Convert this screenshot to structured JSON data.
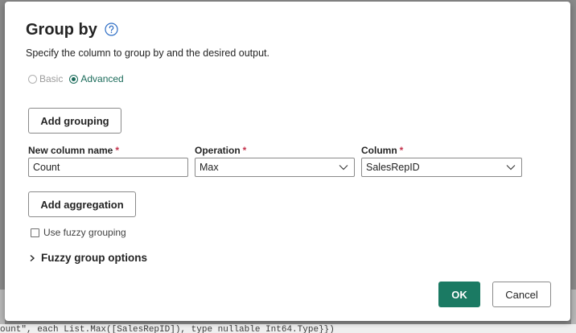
{
  "background": {
    "code_line": "ount\", each List.Max([SalesRepID]), type nullable Int64.Type}})"
  },
  "dialog": {
    "title": "Group by",
    "subtitle": "Specify the column to group by and the desired output.",
    "modes": {
      "basic_label": "Basic",
      "advanced_label": "Advanced",
      "selected": "Advanced"
    },
    "add_grouping_label": "Add grouping",
    "fields": {
      "new_column_name_label": "New column name",
      "new_column_name_value": "Count",
      "operation_label": "Operation",
      "operation_value": "Max",
      "column_label": "Column",
      "column_value": "SalesRepID",
      "required_marker": "*"
    },
    "add_aggregation_label": "Add aggregation",
    "use_fuzzy_grouping_label": "Use fuzzy grouping",
    "use_fuzzy_grouping_checked": false,
    "fuzzy_group_options_label": "Fuzzy group options",
    "ok_label": "OK",
    "cancel_label": "Cancel"
  },
  "colors": {
    "accent": "#1b7a63",
    "required": "#c4314b",
    "help_icon": "#2b6cc4"
  },
  "icons": {
    "help": "help-circle-icon",
    "select": "chevron-down-icon",
    "expander": "chevron-right-icon"
  }
}
